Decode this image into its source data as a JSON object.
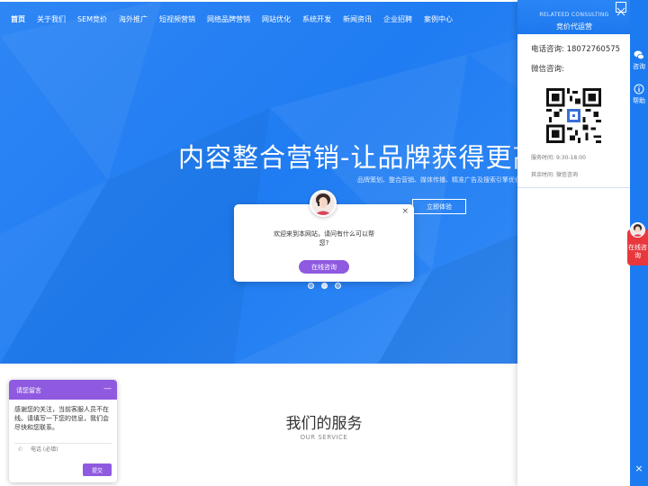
{
  "nav": {
    "items": [
      {
        "label": "首页",
        "active": true
      },
      {
        "label": "关于我们"
      },
      {
        "label": "SEM竞价"
      },
      {
        "label": "海外推广"
      },
      {
        "label": "短视频营销"
      },
      {
        "label": "网络品牌营销"
      },
      {
        "label": "网站优化"
      },
      {
        "label": "系统开发"
      },
      {
        "label": "新闻资讯"
      },
      {
        "label": "企业招聘"
      },
      {
        "label": "案例中心"
      }
    ]
  },
  "hero": {
    "title": "内容整合营销-让品牌获得更高",
    "subtitle": "品牌策划、整合营销、媒体传播、精准广告及搜索引擎优化",
    "button_label": "立即体验"
  },
  "carousel": {
    "dot_count": 3,
    "active_index": 1
  },
  "chat_popup": {
    "message": "欢迎来到本网站，请问有什么可以帮您?",
    "button_label": "在线咨询",
    "close_icon": "×"
  },
  "services": {
    "title": "我们的服务",
    "subtitle": "OUR SERVICE"
  },
  "right_panel": {
    "header_en": "RELATEED CONSULTING",
    "header_cn": "竞价代运营",
    "phone_label": "电话咨询:",
    "phone_value": "18072760575",
    "wechat_label": "微信咨询:",
    "hours_label": "服务时间:",
    "hours_value": "9:30-18:00",
    "other_label": "其余时间:",
    "other_value": "微信咨询"
  },
  "right_bar": {
    "consult_label": "咨询",
    "help_label": "帮助",
    "close_icon": "×"
  },
  "float_button": {
    "label": "在线咨询"
  },
  "message_box": {
    "title": "请您留言",
    "minimize_icon": "—",
    "text": "感谢您的关注，当前客服人员不在线。请填写一下您的信息，我们会尽快和您联系。",
    "phone_placeholder": "电话 (必填)",
    "submit_label": "提交"
  },
  "colors": {
    "hero_blue": "#1f7cf2",
    "accent_purple": "#8f5ae0",
    "float_red": "#e8383d"
  }
}
